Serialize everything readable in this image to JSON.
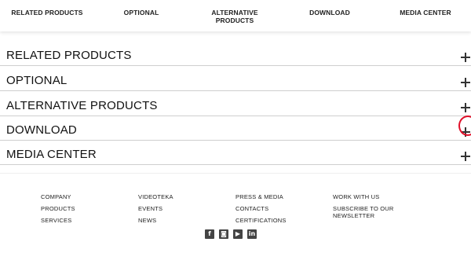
{
  "topnav": {
    "items": [
      {
        "label": "RELATED PRODUCTS"
      },
      {
        "label": "OPTIONAL"
      },
      {
        "label": "ALTERNATIVE PRODUCTS"
      },
      {
        "label": "DOWNLOAD"
      },
      {
        "label": "MEDIA CENTER"
      }
    ]
  },
  "accordion": {
    "sections": [
      {
        "label": "RELATED PRODUCTS",
        "icon": "plus-icon"
      },
      {
        "label": "OPTIONAL",
        "icon": "plus-icon"
      },
      {
        "label": "ALTERNATIVE PRODUCTS",
        "icon": "plus-icon"
      },
      {
        "label": "DOWNLOAD",
        "icon": "plus-icon"
      },
      {
        "label": "MEDIA CENTER",
        "icon": "plus-icon"
      }
    ],
    "highlight_color": "#e0102a"
  },
  "footer": {
    "columns": [
      [
        "COMPANY",
        "PRODUCTS",
        "SERVICES"
      ],
      [
        "VIDEOTEKA",
        "EVENTS",
        "NEWS"
      ],
      [
        "PRESS & MEDIA",
        "CONTACTS",
        "CERTIFICATIONS"
      ],
      [
        "WORK WITH US",
        "SUBSCRIBE TO OUR NEWSLETTER"
      ]
    ],
    "social": [
      {
        "icon": "facebook-icon",
        "glyph": "f"
      },
      {
        "icon": "instagram-icon",
        "glyph": "◙"
      },
      {
        "icon": "youtube-icon",
        "glyph": "▶"
      },
      {
        "icon": "linkedin-icon",
        "glyph": "in"
      }
    ]
  }
}
